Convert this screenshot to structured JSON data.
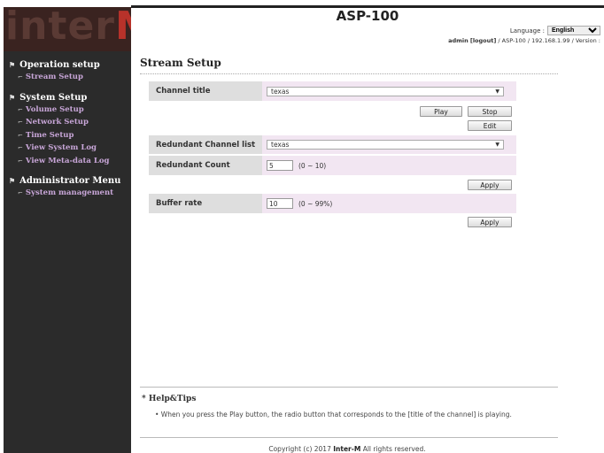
{
  "brand": {
    "logo_text": "interM"
  },
  "header": {
    "title": "ASP-100",
    "language_label": "Language :",
    "language_value": "English",
    "user": "admin",
    "logout": "[logout]",
    "path": "/ ASP-100 / 192.168.1.99 / Version :"
  },
  "sidebar": {
    "groups": [
      {
        "title": "Operation setup",
        "items": [
          "Stream Setup"
        ]
      },
      {
        "title": "System Setup",
        "items": [
          "Volume Setup",
          "Network Setup",
          "Time Setup",
          "View System Log",
          "View Meta-data Log"
        ]
      },
      {
        "title": "Administrator Menu",
        "items": [
          "System management"
        ]
      }
    ]
  },
  "main": {
    "page_title": "Stream Setup",
    "channel_title_label": "Channel title",
    "channel_title_value": "texas",
    "play_label": "Play",
    "stop_label": "Stop",
    "edit_label": "Edit",
    "redundant_list_label": "Redundant Channel list",
    "redundant_list_value": "texas",
    "redundant_count_label": "Redundant Count",
    "redundant_count_value": "5",
    "redundant_count_range": "(0 ~ 10)",
    "apply_label": "Apply",
    "buffer_rate_label": "Buffer rate",
    "buffer_rate_value": "10",
    "buffer_rate_range": "(0 ~ 99%)"
  },
  "help": {
    "title": "* Help&Tips",
    "text": "• When you press the Play button, the radio button that corresponds to the [title of the channel] is playing."
  },
  "footer": {
    "copyright_prefix": "Copyright (c) 2017 ",
    "brand": "Inter-M",
    "copyright_suffix": " All rights reserved."
  }
}
